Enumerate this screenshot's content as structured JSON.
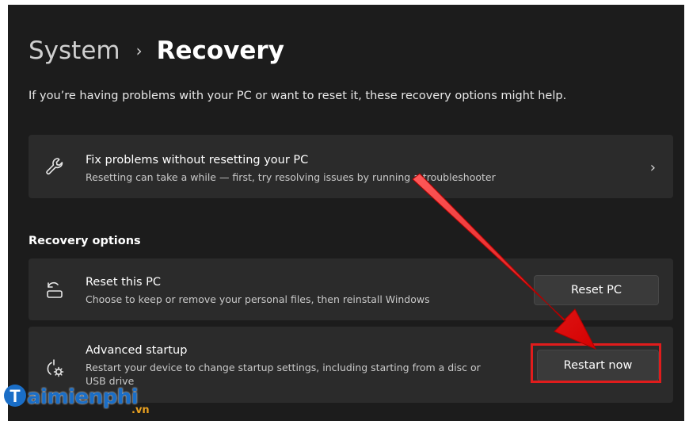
{
  "header": {
    "parent": "System",
    "separator": "›",
    "current": "Recovery"
  },
  "subtitle": "If you’re having problems with your PC or want to reset it, these recovery options might help.",
  "fix_card": {
    "icon": "wrench-icon",
    "title": "Fix problems without resetting your PC",
    "description": "Resetting can take a while — first, try resolving issues by running a troubleshooter",
    "chevron": "›"
  },
  "section_label": "Recovery options",
  "reset_card": {
    "icon": "reset-pc-icon",
    "title": "Reset this PC",
    "description": "Choose to keep or remove your personal files, then reinstall Windows",
    "button": "Reset PC"
  },
  "advanced_card": {
    "icon": "advanced-startup-icon",
    "title": "Advanced startup",
    "description_line1": "Restart your device to change startup settings, including starting from a disc or",
    "description_line2": "USB drive",
    "button": "Restart now"
  },
  "watermark": {
    "brand": "aimienphi",
    "initial": "T",
    "suffix": ".vn"
  },
  "colors": {
    "background": "#1c1c1c",
    "card": "#2b2b2b",
    "annotation": "#e01c1c",
    "brand_blue": "#1a6ec7"
  }
}
